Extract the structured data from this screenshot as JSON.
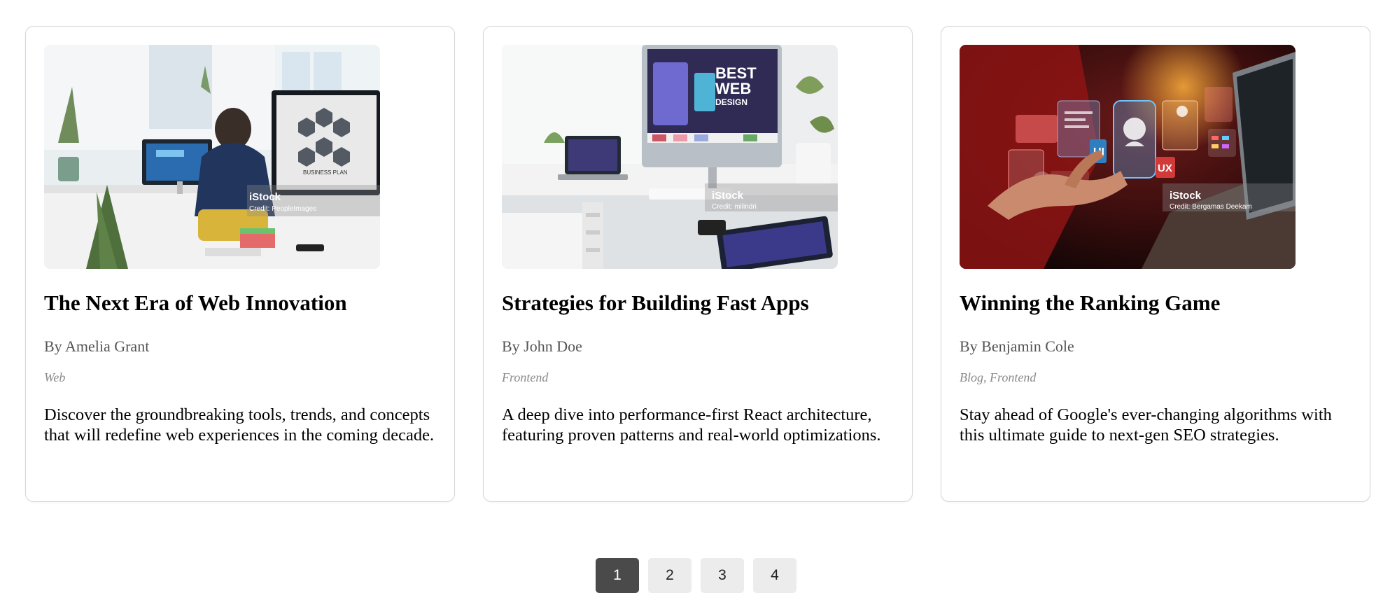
{
  "cards": [
    {
      "title": "The Next Era of Web Innovation",
      "author": "By Amelia Grant",
      "category": "Web",
      "excerpt": "Discover the groundbreaking tools, trends, and concepts that will redefine web experiences in the coming decade.",
      "image": {
        "watermark": "iStock",
        "credit": "Credit: PeopleImages",
        "screen_text": "BUSINESS PLAN"
      }
    },
    {
      "title": "Strategies for Building Fast Apps",
      "author": "By John Doe",
      "category": "Frontend",
      "excerpt": "A deep dive into performance-first React architecture, featuring proven patterns and real-world optimizations.",
      "image": {
        "watermark": "iStock",
        "credit": "Credit: milindri",
        "screen_text_line1": "BEST",
        "screen_text_line2": "WEB",
        "screen_text_line3": "DESIGN"
      }
    },
    {
      "title": "Winning the Ranking Game",
      "author": "By Benjamin Cole",
      "category": "Blog, Frontend",
      "excerpt": "Stay ahead of Google's ever-changing algorithms with this ultimate guide to next-gen SEO strategies.",
      "image": {
        "watermark": "iStock",
        "credit": "Credit: Bergamas Deekam",
        "ui_label": "UI",
        "ux_label": "UX"
      }
    }
  ],
  "pagination": {
    "pages": [
      "1",
      "2",
      "3",
      "4"
    ],
    "active_page": "1"
  },
  "colors": {
    "active_page_bg": "#4a4a4a",
    "inactive_page_bg": "#ececec",
    "card_border": "#d6d6d6",
    "author_text": "#555555",
    "category_text": "#8a8a8a"
  }
}
